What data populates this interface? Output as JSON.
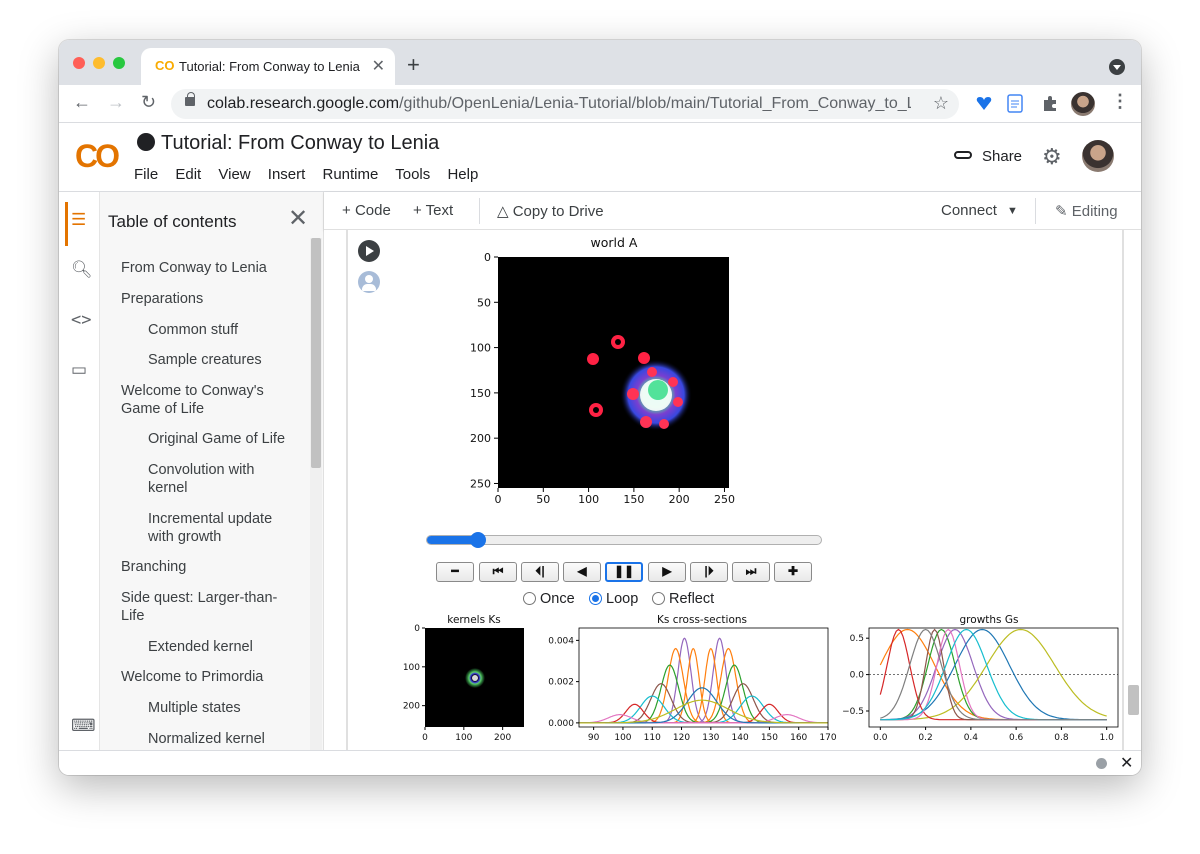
{
  "browser": {
    "tab_title": "Tutorial: From Conway to Lenia",
    "tab_favicon": "CO",
    "url_host": "colab.research.google.com",
    "url_path": "/github/OpenLenia/Lenia-Tutorial/blob/main/Tutorial_From_Conway_to_L..."
  },
  "colab": {
    "logo": "CO",
    "notebook_title": "Tutorial: From Conway to Lenia",
    "menu": [
      "File",
      "Edit",
      "View",
      "Insert",
      "Runtime",
      "Tools",
      "Help"
    ],
    "share_label": "Share"
  },
  "toolbar": {
    "code_label": "Code",
    "text_label": "Text",
    "copy_label": "Copy to Drive",
    "connect_label": "Connect",
    "editing_label": "Editing"
  },
  "toc": {
    "heading": "Table of contents",
    "items": [
      {
        "label": "From Conway to Lenia",
        "level": 1
      },
      {
        "label": "Preparations",
        "level": 1
      },
      {
        "label": "Common stuff",
        "level": 2
      },
      {
        "label": "Sample creatures",
        "level": 2
      },
      {
        "label": "Welcome to Conway's Game of Life",
        "level": 1
      },
      {
        "label": "Original Game of Life",
        "level": 2
      },
      {
        "label": "Convolution with kernel",
        "level": 2
      },
      {
        "label": "Incremental update with growth",
        "level": 2
      },
      {
        "label": "Branching",
        "level": 1
      },
      {
        "label": "Side quest: Larger-than-Life",
        "level": 1
      },
      {
        "label": "Extended kernel",
        "level": 2
      },
      {
        "label": "Welcome to Primordia",
        "level": 1
      },
      {
        "label": "Multiple states",
        "level": 2
      },
      {
        "label": "Normalized kernel",
        "level": 2
      }
    ]
  },
  "player": {
    "slider_fraction": 0.13,
    "buttons": [
      "minus",
      "first",
      "prev-frame",
      "reverse",
      "pause",
      "play",
      "next-frame",
      "last",
      "plus"
    ],
    "modes": [
      "Once",
      "Loop",
      "Reflect"
    ],
    "selected_mode": "Loop"
  },
  "icons": {
    "rail": [
      "list-icon",
      "search-icon",
      "code-icon",
      "folder-icon",
      "terminal-icon"
    ],
    "accent": "#e37400",
    "brand": "#f9ab00"
  },
  "chart_data": [
    {
      "type": "heatmap",
      "title": "world A",
      "xticks": [
        0,
        50,
        100,
        150,
        200,
        250
      ],
      "yticks": [
        0,
        50,
        100,
        150,
        200,
        250
      ],
      "xlim": [
        0,
        255
      ],
      "ylim": [
        255,
        0
      ]
    },
    {
      "type": "heatmap",
      "title": "kernels Ks",
      "xticks": [
        0,
        100,
        200
      ],
      "yticks": [
        0,
        100,
        200
      ]
    },
    {
      "type": "line",
      "title": "Ks cross-sections",
      "xticks": [
        90,
        100,
        110,
        120,
        130,
        140,
        150,
        160,
        170
      ],
      "yticks": [
        "0.000",
        "0.002",
        "0.004"
      ],
      "xlim": [
        85,
        170
      ],
      "ylim": [
        -0.0002,
        0.0046
      ],
      "series": [
        {
          "center": 121,
          "peak": 0.0041,
          "width": 2.2,
          "color": "#9467bd"
        },
        {
          "center": 133,
          "peak": 0.0041,
          "width": 2.2,
          "color": "#9467bd"
        },
        {
          "center": 118,
          "peak": 0.0036,
          "width": 2.6,
          "color": "#ff7f0e"
        },
        {
          "center": 136,
          "peak": 0.0036,
          "width": 2.6,
          "color": "#ff7f0e"
        },
        {
          "center": 124,
          "peak": 0.0036,
          "width": 2.0,
          "color": "#ff7f0e"
        },
        {
          "center": 130,
          "peak": 0.0036,
          "width": 2.0,
          "color": "#ff7f0e"
        },
        {
          "center": 116,
          "peak": 0.0028,
          "width": 3.0,
          "color": "#2ca02c"
        },
        {
          "center": 138,
          "peak": 0.0028,
          "width": 3.0,
          "color": "#2ca02c"
        },
        {
          "center": 113,
          "peak": 0.0019,
          "width": 3.5,
          "color": "#8c564b"
        },
        {
          "center": 141,
          "peak": 0.0019,
          "width": 3.5,
          "color": "#8c564b"
        },
        {
          "center": 110,
          "peak": 0.0013,
          "width": 4.0,
          "color": "#17becf"
        },
        {
          "center": 144,
          "peak": 0.0013,
          "width": 4.0,
          "color": "#17becf"
        },
        {
          "center": 104,
          "peak": 0.0009,
          "width": 3.0,
          "color": "#d62728"
        },
        {
          "center": 150,
          "peak": 0.0009,
          "width": 3.0,
          "color": "#d62728"
        },
        {
          "center": 99,
          "peak": 0.0004,
          "width": 4.0,
          "color": "#e377c2"
        },
        {
          "center": 156,
          "peak": 0.0004,
          "width": 4.0,
          "color": "#e377c2"
        },
        {
          "center": 127,
          "peak": 0.0017,
          "width": 5.0,
          "color": "#1f77b4"
        },
        {
          "center": 127,
          "peak": 0.0011,
          "width": 9.0,
          "color": "#bcbd22"
        }
      ]
    },
    {
      "type": "line",
      "title": "growths Gs",
      "xticks": [
        "0.0",
        "0.2",
        "0.4",
        "0.6",
        "0.8",
        "1.0"
      ],
      "yticks": [
        "0.5",
        "0.0",
        "−0.5"
      ],
      "xlim": [
        -0.05,
        1.05
      ],
      "ylim": [
        -0.72,
        0.64
      ],
      "series": [
        {
          "mu": 0.12,
          "sigma": 0.12,
          "color": "#ff7f0e"
        },
        {
          "mu": 0.27,
          "sigma": 0.06,
          "color": "#2ca02c"
        },
        {
          "mu": 0.33,
          "sigma": 0.08,
          "color": "#9467bd"
        },
        {
          "mu": 0.45,
          "sigma": 0.12,
          "color": "#1f77b4"
        },
        {
          "mu": 0.62,
          "sigma": 0.15,
          "color": "#bcbd22"
        },
        {
          "mu": 0.08,
          "sigma": 0.05,
          "color": "#d62728"
        },
        {
          "mu": 0.24,
          "sigma": 0.04,
          "color": "#8c564b"
        },
        {
          "mu": 0.3,
          "sigma": 0.05,
          "color": "#e377c2"
        },
        {
          "mu": 0.38,
          "sigma": 0.09,
          "color": "#17becf"
        },
        {
          "mu": 0.2,
          "sigma": 0.07,
          "color": "#7f7f7f"
        }
      ]
    }
  ]
}
